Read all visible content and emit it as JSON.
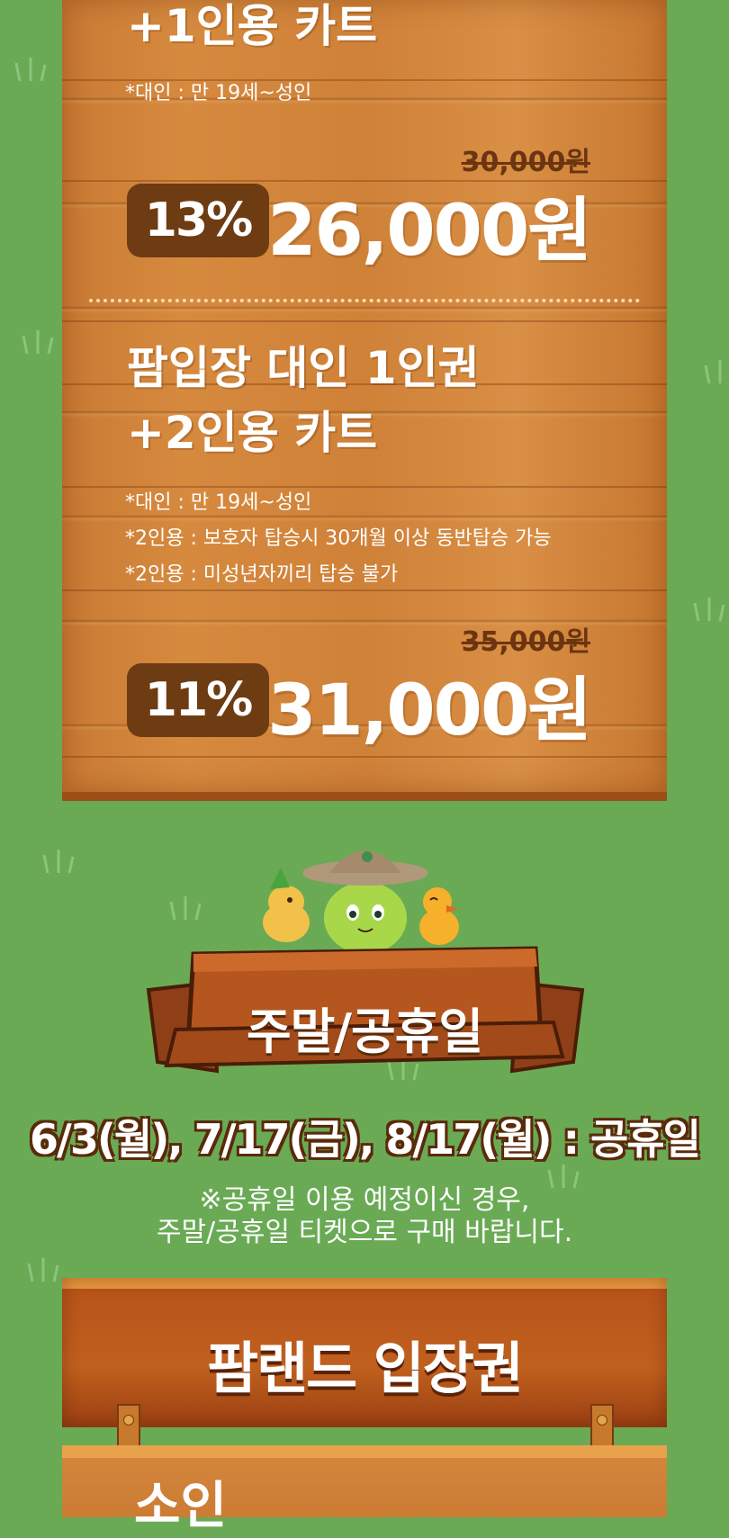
{
  "ticket1": {
    "title_line2": "+1인용 카트",
    "notes": [
      "*대인 : 만 19세~성인"
    ],
    "original_price": "30,000원",
    "discount": "13%",
    "price": "26,000원"
  },
  "ticket2": {
    "title_line1": "팜입장 대인 1인권",
    "title_line2": "+2인용 카트",
    "notes": [
      "*대인 : 만 19세~성인",
      "*2인용 : 보호자 탑승시 30개월 이상 동반탑승 가능",
      "*2인용 : 미성년자끼리 탑승 불가"
    ],
    "original_price": "35,000원",
    "discount": "11%",
    "price": "31,000원"
  },
  "weekend": {
    "title": "주말/공휴일",
    "holidays": "6/3(월), 7/17(금), 8/17(월) : 공휴일",
    "note_line1": "※공휴일 이용 예정이신 경우,",
    "note_line2": "주말/공휴일 티켓으로 구매 바랍니다."
  },
  "entry": {
    "title": "팜랜드 입장권",
    "next_title": "소인"
  },
  "colors": {
    "background": "#6aaa55",
    "wood": "#d68a3e",
    "badge": "#6e3c12",
    "entry_wood": "#b8541b"
  }
}
